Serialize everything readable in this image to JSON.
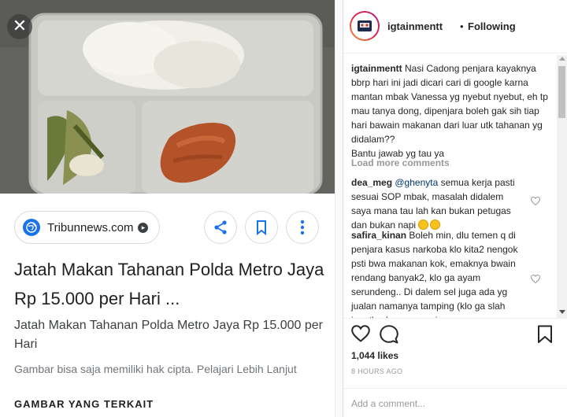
{
  "left_panel": {
    "close_icon": "close-icon",
    "source": {
      "name": "Tribunnews.com"
    },
    "actions": [
      "share-icon",
      "bookmark-icon",
      "more-vert-icon"
    ],
    "title": "Jatah Makan Tahanan Polda Metro Jaya Rp 15.000 per Hari ...",
    "subtitle": "Jatah Makan Tahanan Polda Metro Jaya Rp 15.000 per Hari",
    "copyright_text": "Gambar bisa saja memiliki hak cipta. Pelajari Lebih Lanjut",
    "related_heading": "GAMBAR YANG TERKAIT"
  },
  "instagram": {
    "header": {
      "username": "igtainmentt",
      "separator": "•",
      "follow_status": "Following"
    },
    "caption": {
      "username": "igtainmentt",
      "text": "Nasi Cadong penjara kayaknya bbrp hari ini jadi dicari cari di google karna mantan mbak Vanessa yg nyebut nyebut, eh tp mau tanya dong, dipenjara boleh gak sih tiap hari bawain makanan dari luar utk tahanan yg didalam??",
      "text2": "Bantu jawab yg tau ya"
    },
    "load_more": "Load more comments",
    "comments": [
      {
        "username": "dea_meg",
        "mention": "@ghenyta",
        "text": "semua kerja pasti sesuai SOP mbak, masalah didalem saya mana tau lah kan bukan petugas dan bukan napi"
      },
      {
        "username": "safira_kinan",
        "text": "Boleh min, dlu temen q di penjara kasus narkoba klo kita2 nengok psti bwa makanan kok, emaknya bwain rendang banyak2, klo ga ayam serundeng.. Di dalem sel juga ada yg jualan namanya tamping (klo ga slah inget) ada nasgor migor.."
      }
    ],
    "likes": "1,044 likes",
    "time": "8 HOURS AGO",
    "add_comment_placeholder": "Add a comment..."
  },
  "colors": {
    "brand_blue": "#1a73e8",
    "ig_text": "#262626",
    "muted": "#999999"
  }
}
